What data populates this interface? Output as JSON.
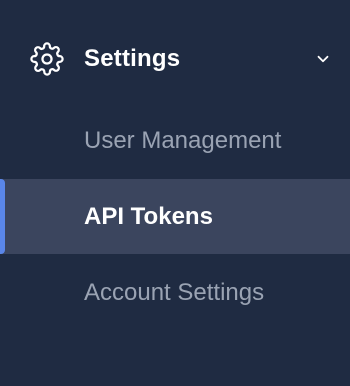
{
  "nav": {
    "section": {
      "label": "Settings",
      "icon": "gear-icon",
      "expanded": true,
      "toggle_icon": "chevron-down-icon"
    },
    "items": [
      {
        "label": "User Management",
        "active": false
      },
      {
        "label": "API Tokens",
        "active": true
      },
      {
        "label": "Account Settings",
        "active": false
      }
    ]
  },
  "colors": {
    "background": "#1f2b42",
    "active_row": "#3b455e",
    "active_indicator": "#5a86e8",
    "text_active": "#ffffff",
    "text_inactive": "#9aa3b3"
  }
}
